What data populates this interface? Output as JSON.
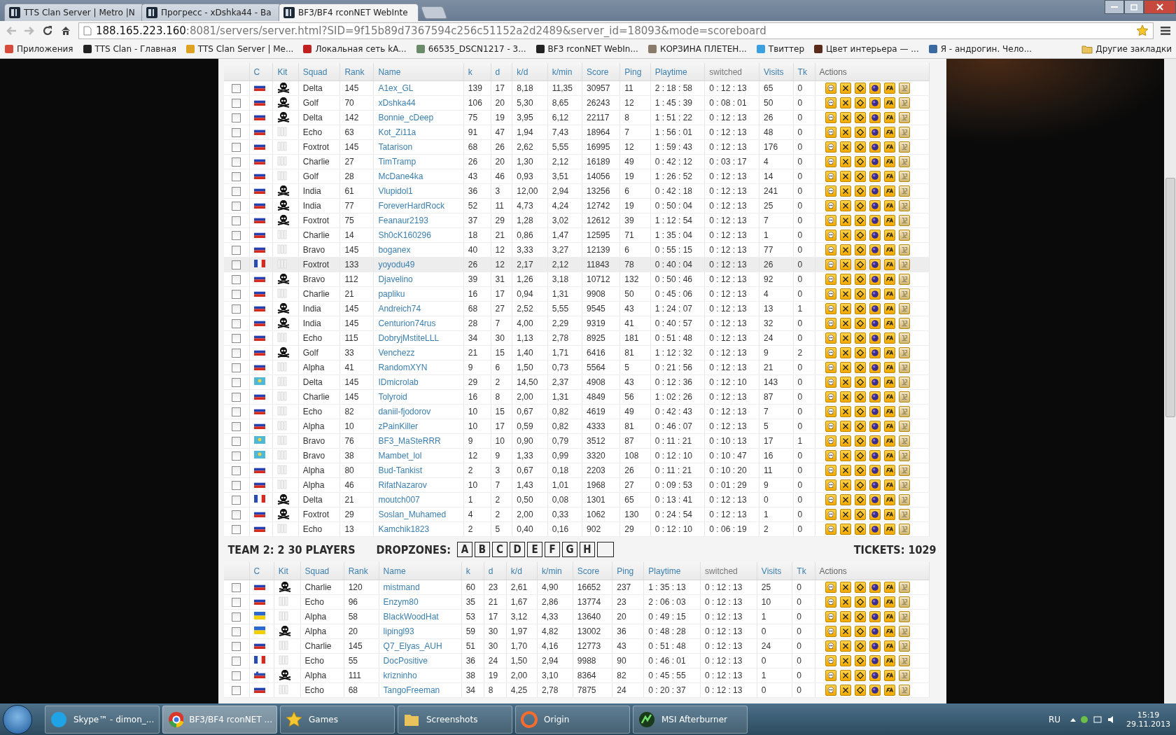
{
  "browser": {
    "tabs": [
      {
        "title": "TTS Clan Server | Metro |N",
        "selected": false
      },
      {
        "title": "Прогресс - xDshka44 - Ba",
        "selected": false
      },
      {
        "title": "BF3/BF4 rconNET WebInte",
        "selected": true
      }
    ],
    "address": {
      "host": "188.165.223.160",
      "rest": ":8081/servers/server.html?SID=9f15b89d7367594c256c51152a2d2489&server_id=18093&mode=scoreboard"
    },
    "bookmarks": [
      "Приложения",
      "TTS Clan - Главная",
      "TTS Clan Server | Me...",
      "Локальная сеть kA...",
      "66535_DSCN1217 - 3...",
      "BF3 rconNET WebIn...",
      "КОРЗИНА ПЛЕТЕН...",
      "Твиттер",
      "Цвет интерьера — ...",
      "Я - андрогин. Чело..."
    ],
    "other_bookmarks": "Другие закладки"
  },
  "team1_columns": [
    "C",
    "Kit",
    "Squad",
    "Rank",
    "Name",
    "k",
    "d",
    "k/d",
    "k/min",
    "Score",
    "Ping",
    "Playtime",
    "switched",
    "Visits",
    "Tk",
    "Actions"
  ],
  "team1_rows": [
    {
      "checked": false,
      "hover": false,
      "flag": {
        "kind": "ru"
      },
      "kit": {
        "kind": "skull"
      },
      "cells": [
        "Delta",
        "145",
        "A1ex_GL",
        "139",
        "17",
        "8,18",
        "11,35",
        "30957",
        "11",
        "2 : 18 : 58",
        "0 : 12 : 13",
        "65",
        "0"
      ]
    },
    {
      "checked": false,
      "hover": false,
      "flag": {
        "kind": "ru"
      },
      "kit": {
        "kind": "skull"
      },
      "cells": [
        "Golf",
        "70",
        "xDshka44",
        "106",
        "20",
        "5,30",
        "8,65",
        "26243",
        "12",
        "1 : 45 : 39",
        "0 : 08 : 01",
        "50",
        "0"
      ]
    },
    {
      "checked": false,
      "hover": false,
      "flag": {
        "kind": "ru"
      },
      "kit": {
        "kind": "skull"
      },
      "cells": [
        "Delta",
        "142",
        "Bonnie_cDeep",
        "75",
        "19",
        "3,95",
        "6,12",
        "22117",
        "8",
        "1 : 51 : 22",
        "0 : 12 : 13",
        "26",
        "0"
      ]
    },
    {
      "checked": false,
      "hover": false,
      "flag": {
        "kind": "ru"
      },
      "kit": {
        "kind": "blank"
      },
      "cells": [
        "Echo",
        "63",
        "Kot_Zi11a",
        "91",
        "47",
        "1,94",
        "7,43",
        "18964",
        "7",
        "1 : 56 : 01",
        "0 : 12 : 13",
        "48",
        "0"
      ]
    },
    {
      "checked": false,
      "hover": false,
      "flag": {
        "kind": "ru"
      },
      "kit": {
        "kind": "blank"
      },
      "cells": [
        "Foxtrot",
        "145",
        "Tatarison",
        "68",
        "26",
        "2,62",
        "5,55",
        "16995",
        "12",
        "1 : 59 : 43",
        "0 : 12 : 13",
        "176",
        "0"
      ]
    },
    {
      "checked": false,
      "hover": false,
      "flag": {
        "kind": "ru"
      },
      "kit": {
        "kind": "blank"
      },
      "cells": [
        "Charlie",
        "27",
        "TimTramp",
        "26",
        "20",
        "1,30",
        "2,12",
        "16189",
        "49",
        "0 : 42 : 12",
        "0 : 03 : 17",
        "4",
        "0"
      ]
    },
    {
      "checked": false,
      "hover": false,
      "flag": {
        "kind": "ru"
      },
      "kit": {
        "kind": "blank"
      },
      "cells": [
        "Golf",
        "28",
        "McDane4ka",
        "43",
        "46",
        "0,93",
        "3,51",
        "14056",
        "19",
        "1 : 26 : 52",
        "0 : 12 : 13",
        "14",
        "0"
      ]
    },
    {
      "checked": false,
      "hover": false,
      "flag": {
        "kind": "ru"
      },
      "kit": {
        "kind": "skull"
      },
      "cells": [
        "India",
        "61",
        "Vlupidol1",
        "36",
        "3",
        "12,00",
        "2,94",
        "13256",
        "6",
        "0 : 42 : 18",
        "0 : 12 : 13",
        "241",
        "0"
      ]
    },
    {
      "checked": false,
      "hover": false,
      "flag": {
        "kind": "ru"
      },
      "kit": {
        "kind": "skull"
      },
      "cells": [
        "India",
        "77",
        "ForeverHardRock",
        "52",
        "11",
        "4,73",
        "4,24",
        "12742",
        "19",
        "0 : 50 : 04",
        "0 : 12 : 13",
        "25",
        "0"
      ]
    },
    {
      "checked": false,
      "hover": false,
      "flag": {
        "kind": "ru"
      },
      "kit": {
        "kind": "skull"
      },
      "cells": [
        "Foxtrot",
        "75",
        "Feanaur2193",
        "37",
        "29",
        "1,28",
        "3,02",
        "12612",
        "39",
        "1 : 12 : 54",
        "0 : 12 : 13",
        "7",
        "0"
      ]
    },
    {
      "checked": false,
      "hover": false,
      "flag": {
        "kind": "ru"
      },
      "kit": {
        "kind": "blank"
      },
      "cells": [
        "Charlie",
        "14",
        "Sh0cK160296",
        "18",
        "21",
        "0,86",
        "1,47",
        "12595",
        "71",
        "1 : 35 : 04",
        "0 : 12 : 13",
        "1",
        "0"
      ]
    },
    {
      "checked": false,
      "hover": false,
      "flag": {
        "kind": "ru"
      },
      "kit": {
        "kind": "blank"
      },
      "cells": [
        "Bravo",
        "145",
        "boganex",
        "40",
        "12",
        "3,33",
        "3,27",
        "12139",
        "6",
        "0 : 55 : 15",
        "0 : 12 : 13",
        "77",
        "0"
      ]
    },
    {
      "checked": false,
      "hover": true,
      "flag": {
        "kind": "fr"
      },
      "kit": {
        "kind": "blank"
      },
      "cells": [
        "Foxtrot",
        "133",
        "yoyodu49",
        "26",
        "12",
        "2,17",
        "2,12",
        "11843",
        "78",
        "0 : 40 : 04",
        "0 : 12 : 13",
        "26",
        "0"
      ]
    },
    {
      "checked": false,
      "hover": false,
      "flag": {
        "kind": "ru"
      },
      "kit": {
        "kind": "skull"
      },
      "cells": [
        "Bravo",
        "112",
        "Djavelino",
        "39",
        "31",
        "1,26",
        "3,18",
        "10712",
        "132",
        "0 : 50 : 46",
        "0 : 12 : 13",
        "92",
        "0"
      ]
    },
    {
      "checked": false,
      "hover": false,
      "flag": {
        "kind": "ru"
      },
      "kit": {
        "kind": "blank"
      },
      "cells": [
        "Charlie",
        "21",
        "papliku",
        "16",
        "17",
        "0,94",
        "1,31",
        "9908",
        "50",
        "0 : 45 : 06",
        "0 : 12 : 13",
        "4",
        "0"
      ]
    },
    {
      "checked": false,
      "hover": false,
      "flag": {
        "kind": "ru"
      },
      "kit": {
        "kind": "skull"
      },
      "cells": [
        "India",
        "145",
        "Andreich74",
        "68",
        "27",
        "2,52",
        "5,55",
        "9545",
        "43",
        "1 : 24 : 07",
        "0 : 12 : 13",
        "13",
        "1"
      ]
    },
    {
      "checked": false,
      "hover": false,
      "flag": {
        "kind": "ru"
      },
      "kit": {
        "kind": "skull"
      },
      "cells": [
        "India",
        "145",
        "Centurion74rus",
        "28",
        "7",
        "4,00",
        "2,29",
        "9319",
        "41",
        "0 : 40 : 57",
        "0 : 12 : 13",
        "32",
        "0"
      ]
    },
    {
      "checked": false,
      "hover": false,
      "flag": {
        "kind": "ru"
      },
      "kit": {
        "kind": "blank"
      },
      "cells": [
        "Echo",
        "115",
        "DobryjMstiteLLL",
        "34",
        "30",
        "1,13",
        "2,78",
        "8925",
        "181",
        "0 : 51 : 48",
        "0 : 12 : 13",
        "24",
        "0"
      ]
    },
    {
      "checked": false,
      "hover": false,
      "flag": {
        "kind": "ru"
      },
      "kit": {
        "kind": "skull"
      },
      "cells": [
        "Golf",
        "33",
        "Venchezz",
        "21",
        "15",
        "1,40",
        "1,71",
        "6416",
        "81",
        "1 : 12 : 32",
        "0 : 12 : 13",
        "9",
        "2"
      ]
    },
    {
      "checked": false,
      "hover": false,
      "flag": {
        "kind": "ru"
      },
      "kit": {
        "kind": "blank"
      },
      "cells": [
        "Alpha",
        "41",
        "RandomXYN",
        "9",
        "6",
        "1,50",
        "0,73",
        "5564",
        "5",
        "0 : 21 : 56",
        "0 : 12 : 13",
        "21",
        "0"
      ]
    },
    {
      "checked": false,
      "hover": false,
      "flag": {
        "kind": "kz"
      },
      "kit": {
        "kind": "blank"
      },
      "cells": [
        "Delta",
        "145",
        "IDmicrolab",
        "29",
        "2",
        "14,50",
        "2,37",
        "4908",
        "43",
        "0 : 12 : 36",
        "0 : 12 : 10",
        "143",
        "0"
      ]
    },
    {
      "checked": false,
      "hover": false,
      "flag": {
        "kind": "ru"
      },
      "kit": {
        "kind": "blank"
      },
      "cells": [
        "Charlie",
        "145",
        "Tolyroid",
        "16",
        "8",
        "2,00",
        "1,31",
        "4849",
        "56",
        "1 : 02 : 26",
        "0 : 12 : 13",
        "87",
        "0"
      ]
    },
    {
      "checked": false,
      "hover": false,
      "flag": {
        "kind": "ru"
      },
      "kit": {
        "kind": "blank"
      },
      "cells": [
        "Echo",
        "82",
        "daniil-fjodorov",
        "10",
        "15",
        "0,67",
        "0,82",
        "4619",
        "49",
        "0 : 42 : 43",
        "0 : 12 : 13",
        "7",
        "0"
      ]
    },
    {
      "checked": false,
      "hover": false,
      "flag": {
        "kind": "ru"
      },
      "kit": {
        "kind": "blank"
      },
      "cells": [
        "Alpha",
        "10",
        "zPainKiller",
        "10",
        "17",
        "0,59",
        "0,82",
        "4333",
        "81",
        "0 : 46 : 07",
        "0 : 12 : 13",
        "5",
        "0"
      ]
    },
    {
      "checked": false,
      "hover": false,
      "flag": {
        "kind": "kz"
      },
      "kit": {
        "kind": "blank"
      },
      "cells": [
        "Bravo",
        "76",
        "BF3_MaSteRRR",
        "9",
        "10",
        "0,90",
        "0,79",
        "3512",
        "87",
        "0 : 11 : 21",
        "0 : 10 : 13",
        "17",
        "1"
      ]
    },
    {
      "checked": false,
      "hover": false,
      "flag": {
        "kind": "kz"
      },
      "kit": {
        "kind": "blank"
      },
      "cells": [
        "Bravo",
        "38",
        "Mambet_lol",
        "12",
        "9",
        "1,33",
        "0,99",
        "3320",
        "108",
        "0 : 12 : 10",
        "0 : 10 : 47",
        "16",
        "0"
      ]
    },
    {
      "checked": false,
      "hover": false,
      "flag": {
        "kind": "ru"
      },
      "kit": {
        "kind": "blank"
      },
      "cells": [
        "Alpha",
        "80",
        "Bud-Tankist",
        "2",
        "3",
        "0,67",
        "0,18",
        "2203",
        "26",
        "0 : 11 : 21",
        "0 : 10 : 20",
        "11",
        "0"
      ]
    },
    {
      "checked": false,
      "hover": false,
      "flag": {
        "kind": "ru"
      },
      "kit": {
        "kind": "blank"
      },
      "cells": [
        "Alpha",
        "46",
        "RifatNazarov",
        "10",
        "7",
        "1,43",
        "1,01",
        "1968",
        "27",
        "0 : 09 : 53",
        "0 : 01 : 29",
        "9",
        "0"
      ]
    },
    {
      "checked": false,
      "hover": false,
      "flag": {
        "kind": "fr"
      },
      "kit": {
        "kind": "skull"
      },
      "cells": [
        "Delta",
        "21",
        "moutch007",
        "1",
        "2",
        "0,50",
        "0,08",
        "1301",
        "65",
        "0 : 13 : 41",
        "0 : 12 : 13",
        "0",
        "0"
      ]
    },
    {
      "checked": false,
      "hover": false,
      "flag": {
        "kind": "ru"
      },
      "kit": {
        "kind": "skull"
      },
      "cells": [
        "Foxtrot",
        "29",
        "Soslan_Muhamed",
        "4",
        "2",
        "2,00",
        "0,33",
        "1062",
        "130",
        "0 : 24 : 54",
        "0 : 12 : 13",
        "1",
        "0"
      ]
    },
    {
      "checked": false,
      "hover": false,
      "flag": {
        "kind": "ru"
      },
      "kit": {
        "kind": "blank"
      },
      "cells": [
        "Echo",
        "13",
        "Kamchik1823",
        "2",
        "5",
        "0,40",
        "0,16",
        "902",
        "29",
        "0 : 12 : 10",
        "0 : 06 : 19",
        "2",
        "0"
      ]
    }
  ],
  "team2": {
    "title": "TEAM 2: 2 30 PLAYERS",
    "dropzones_label": "DROPZONES:",
    "dropzones": [
      {
        "kind": "letter",
        "label": "A"
      },
      {
        "kind": "letter",
        "label": "B"
      },
      {
        "kind": "letter",
        "label": "C"
      },
      {
        "kind": "letter",
        "label": "D"
      },
      {
        "kind": "letter",
        "label": "E"
      },
      {
        "kind": "letter",
        "label": "F"
      },
      {
        "kind": "letter",
        "label": "G"
      },
      {
        "kind": "letter",
        "label": "H"
      },
      {
        "kind": "blank"
      }
    ],
    "tickets": "TICKETS: 1029"
  },
  "team2_columns": [
    "C",
    "Kit",
    "Squad",
    "Rank",
    "Name",
    "k",
    "d",
    "k/d",
    "k/min",
    "Score",
    "Ping",
    "Playtime",
    "switched",
    "Visits",
    "Tk",
    "Actions"
  ],
  "team2_rows": [
    {
      "checked": false,
      "hover": false,
      "flag": {
        "kind": "ru"
      },
      "kit": {
        "kind": "skull"
      },
      "cells": [
        "Charlie",
        "120",
        "mistmand",
        "60",
        "23",
        "2,61",
        "4,90",
        "16652",
        "237",
        "1 : 35 : 13",
        "0 : 12 : 13",
        "25",
        "0"
      ]
    },
    {
      "checked": false,
      "hover": false,
      "flag": {
        "kind": "ru"
      },
      "kit": {
        "kind": "blank"
      },
      "cells": [
        "Echo",
        "96",
        "Enzym80",
        "35",
        "21",
        "1,67",
        "2,86",
        "13774",
        "23",
        "2 : 06 : 03",
        "0 : 12 : 13",
        "10",
        "0"
      ]
    },
    {
      "checked": false,
      "hover": false,
      "flag": {
        "kind": "ua"
      },
      "kit": {
        "kind": "blank"
      },
      "cells": [
        "Alpha",
        "58",
        "BlackWoodHat",
        "53",
        "17",
        "3,12",
        "4,33",
        "13640",
        "20",
        "0 : 49 : 15",
        "0 : 12 : 13",
        "1",
        "0"
      ]
    },
    {
      "checked": false,
      "hover": false,
      "flag": {
        "kind": "ua"
      },
      "kit": {
        "kind": "skull"
      },
      "cells": [
        "Alpha",
        "20",
        "lipingl93",
        "59",
        "30",
        "1,97",
        "4,82",
        "13002",
        "36",
        "0 : 48 : 28",
        "0 : 12 : 13",
        "0",
        "0"
      ]
    },
    {
      "checked": false,
      "hover": false,
      "flag": {
        "kind": "ru"
      },
      "kit": {
        "kind": "blank"
      },
      "cells": [
        "Charlie",
        "145",
        "Q7_Elyas_AUH",
        "51",
        "30",
        "1,70",
        "4,16",
        "12773",
        "43",
        "0 : 51 : 48",
        "0 : 12 : 13",
        "24",
        "0"
      ]
    },
    {
      "checked": false,
      "hover": false,
      "flag": {
        "kind": "fr"
      },
      "kit": {
        "kind": "blank"
      },
      "cells": [
        "Echo",
        "55",
        "DocPositive",
        "36",
        "24",
        "1,50",
        "2,94",
        "9988",
        "90",
        "0 : 46 : 01",
        "0 : 12 : 13",
        "0",
        "0"
      ]
    },
    {
      "checked": false,
      "hover": false,
      "flag": {
        "kind": "si"
      },
      "kit": {
        "kind": "skull"
      },
      "cells": [
        "Alpha",
        "111",
        "krizninho",
        "38",
        "19",
        "2,00",
        "3,10",
        "8364",
        "82",
        "0 : 45 : 55",
        "0 : 12 : 13",
        "1",
        "0"
      ]
    },
    {
      "checked": false,
      "hover": false,
      "flag": {
        "kind": "ru"
      },
      "kit": {
        "kind": "blank"
      },
      "cells": [
        "Echo",
        "68",
        "TangoFreeman",
        "34",
        "8",
        "4,25",
        "2,78",
        "7875",
        "24",
        "0 : 20 : 37",
        "0 : 12 : 13",
        "0",
        "0"
      ]
    }
  ],
  "taskbar": {
    "items": [
      {
        "kind": "skype",
        "label": "Skype™ - dimon_...",
        "selected": false
      },
      {
        "kind": "chrome",
        "label": "BF3/BF4 rconNET ...",
        "selected": true
      },
      {
        "kind": "star",
        "label": "Games",
        "selected": false
      },
      {
        "kind": "folder",
        "label": "Screenshots",
        "selected": false
      },
      {
        "kind": "origin",
        "label": "Origin",
        "selected": false
      },
      {
        "kind": "msi",
        "label": "MSI Afterburner",
        "selected": false
      }
    ],
    "language": "RU",
    "time": "15:19",
    "date": "29.11.2013"
  }
}
